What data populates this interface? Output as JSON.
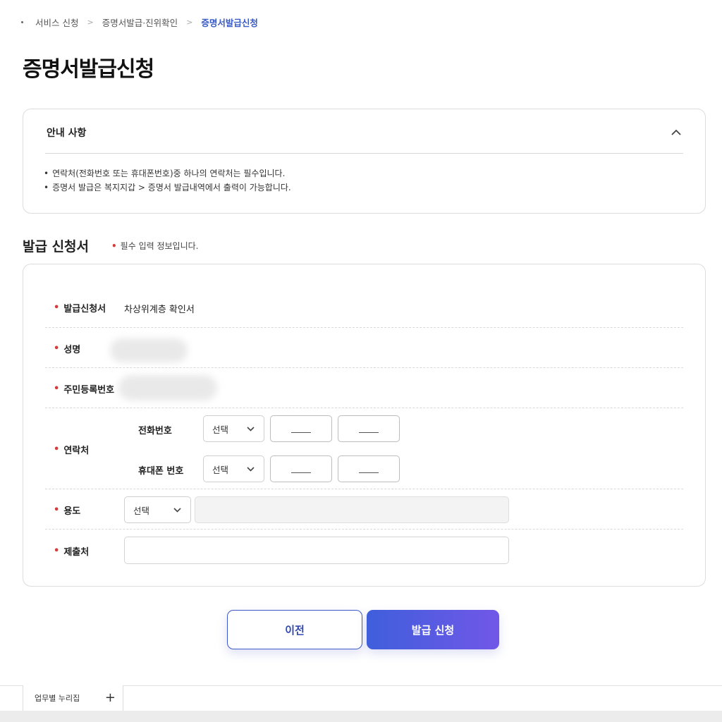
{
  "breadcrumb": {
    "items": [
      "서비스 신청",
      "증명서발급·진위확인",
      "증명서발급신청"
    ]
  },
  "page_title": "증명서발급신청",
  "notice": {
    "title": "안내 사항",
    "items": [
      "연락처(전화번호 또는 휴대폰번호)중 하나의 연락처는 필수입니다.",
      "증명서 발급은 복지지갑 > 증명서 발급내역에서 출력이 가능합니다."
    ]
  },
  "form": {
    "section_title": "발급 신청서",
    "required_marker": "•",
    "required_note": "필수 입력 정보입니다.",
    "fields": {
      "certificate": {
        "label": "발급신청서",
        "value": "차상위계층 확인서"
      },
      "name": {
        "label": "성명"
      },
      "resident_number": {
        "label": "주민등록번호"
      },
      "contact": {
        "label": "연락처",
        "phone_label": "전화번호",
        "mobile_label": "휴대폰 번호",
        "phone_select": "선택",
        "mobile_select": "선택"
      },
      "purpose": {
        "label": "용도",
        "select": "선택"
      },
      "submit_to": {
        "label": "제출처"
      }
    }
  },
  "buttons": {
    "prev": "이전",
    "submit": "발급 신청"
  },
  "bottom_tab": {
    "label": "업무별 누리집",
    "plus": "+"
  },
  "colors": {
    "accent": "#3b5cc7",
    "required": "#d43b3b",
    "submit_gradient_start": "#3f5fdc",
    "submit_gradient_end": "#7157e8"
  },
  "icons": {
    "collapse": "chevron-up-icon",
    "select": "chevron-down-icon",
    "separator": "chevron-right-icon",
    "add": "plus-icon"
  }
}
